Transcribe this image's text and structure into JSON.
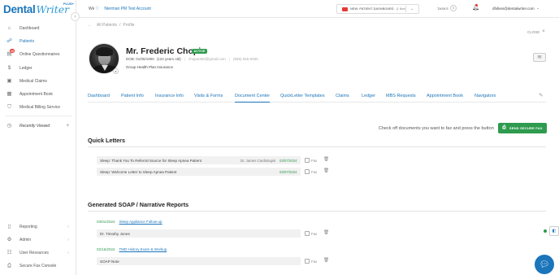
{
  "app": {
    "logo_main": "Dental",
    "logo_script": "Writer",
    "logo_plus": "PLUS+",
    "collapse_icon": "‹"
  },
  "sidebar": {
    "items": [
      {
        "label": "Dashboard",
        "icon": "home-icon",
        "glyph": "⌂"
      },
      {
        "label": "Patients",
        "icon": "users-icon",
        "glyph": "☍"
      },
      {
        "label": "Online Questionnaires",
        "icon": "questionnaire-icon",
        "glyph": "▤",
        "badge": "29"
      },
      {
        "label": "Ledger",
        "icon": "dollar-icon",
        "glyph": "$"
      },
      {
        "label": "Medical Claims",
        "icon": "claims-icon",
        "glyph": "▣"
      },
      {
        "label": "Appointment Book",
        "icon": "calendar-icon",
        "glyph": "▦"
      },
      {
        "label": "Medical Billing Service",
        "icon": "shield-icon",
        "glyph": "⛉"
      },
      {
        "label": "Recently Viewed",
        "icon": "clock-icon",
        "glyph": "◷",
        "action": "+"
      },
      {
        "label": "Reporting",
        "icon": "file-icon",
        "glyph": "▯",
        "chevron": "›"
      },
      {
        "label": "Admin",
        "icon": "admin-icon",
        "glyph": "⚙",
        "chevron": "›"
      },
      {
        "label": "User Resources",
        "icon": "resources-icon",
        "glyph": "☷",
        "chevron": "›"
      },
      {
        "label": "Secure Fax Console",
        "icon": "fax-icon",
        "glyph": "⎙"
      }
    ]
  },
  "topbar": {
    "we_label": "We",
    "office_name": "Nierman PM Test Account",
    "patient_dashboard": "New: Patient Dashboard",
    "patient_dashboard_count": "(1 New)",
    "tasks_label": "TASKS",
    "tasks_count": "0",
    "user_email": "dfolkes@dentalwriter.com",
    "chevron": "⌄"
  },
  "breadcrumb": {
    "parent": "All Patients",
    "separator": "/",
    "current": "Profile",
    "back_arrow": "←"
  },
  "close": {
    "label": "CLOSE",
    "icon": "×"
  },
  "patient": {
    "name": "Mr. Frederic Chopin",
    "status": "ACTIVE",
    "dob": "DOB: 01/06/1900",
    "age": "(124 years old)",
    "email": "chojan353@gmail.com",
    "phone": "(555) 555-5555",
    "plan": "Group Health Plan Insurance"
  },
  "tabs": [
    {
      "label": "Dashboard"
    },
    {
      "label": "Patient Info"
    },
    {
      "label": "Insurance Info"
    },
    {
      "label": "Visits & Forms"
    },
    {
      "label": "Document Center",
      "active": true
    },
    {
      "label": "QuickLetter Templates"
    },
    {
      "label": "Claims"
    },
    {
      "label": "Ledger"
    },
    {
      "label": "MBS Requests"
    },
    {
      "label": "Appointment Book"
    },
    {
      "label": "Navigators"
    }
  ],
  "document_center": {
    "instruction": "Check off documents you want to fax and press the button",
    "fax_button": "SEND SECURE FAX",
    "quick_letters_title": "Quick Letters",
    "fax_label": "Fax",
    "quick_letters": [
      {
        "title": "Sleep: Thank You To Referral Source for Sleep Apnea Patient",
        "who": "Dr. James Cardiologist",
        "date": "03/07/2024"
      },
      {
        "title": "Sleep: Welcome Letter to Sleep Apnea Patient",
        "who": "",
        "date": "03/07/2024"
      }
    ],
    "reports_title": "Generated SOAP / Narrative Reports",
    "reports": [
      {
        "date": "03/01/2024",
        "link": "Sleep Appliance Follow-up",
        "item": "Dr. Timothy Jones"
      },
      {
        "date": "02/16/2024",
        "link": "TMD History Exam & Workup",
        "item": "SOAP Note"
      }
    ]
  },
  "colors": {
    "brand": "#1b75bb",
    "success": "#2e9b4e",
    "alert": "#e53935"
  }
}
